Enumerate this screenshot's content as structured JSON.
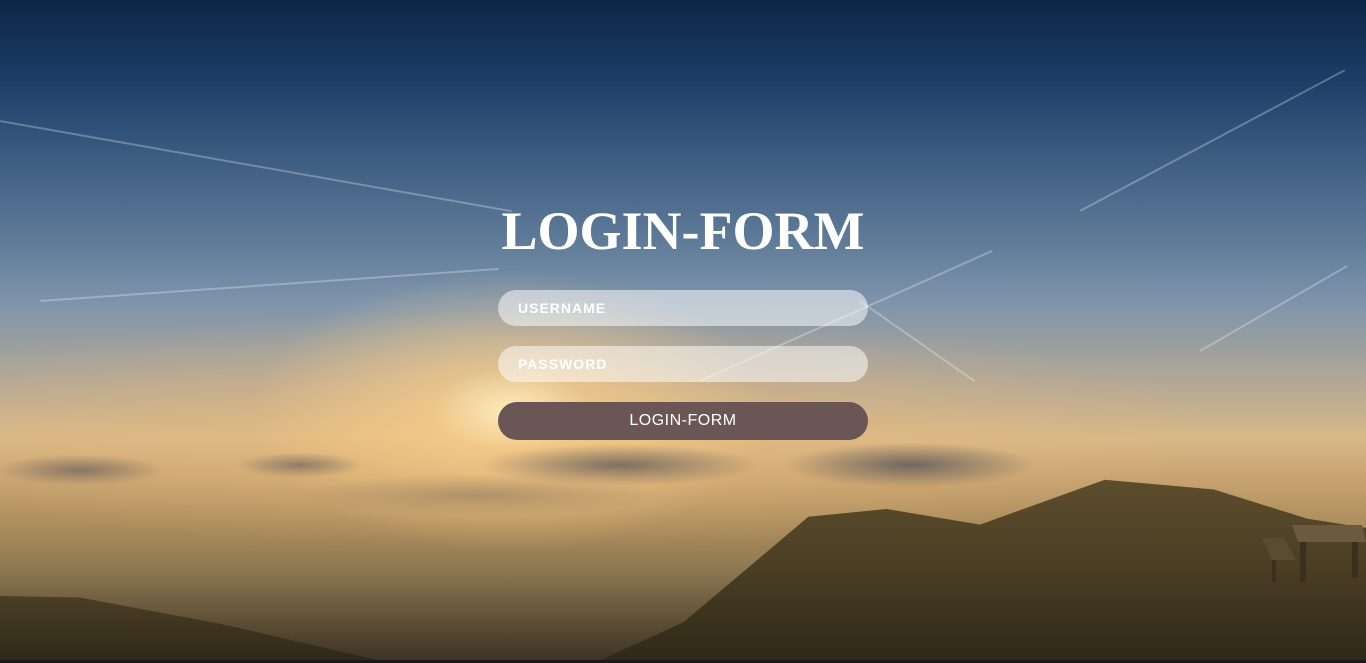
{
  "form": {
    "title": "LOGIN-FORM",
    "username_placeholder": "USERNAME",
    "password_placeholder": "PASSWORD",
    "submit_label": "LOGIN-FORM"
  },
  "colors": {
    "button_bg": "#6a5755",
    "title_color": "#ffffff",
    "field_bg": "rgba(255,255,255,0.52)"
  }
}
